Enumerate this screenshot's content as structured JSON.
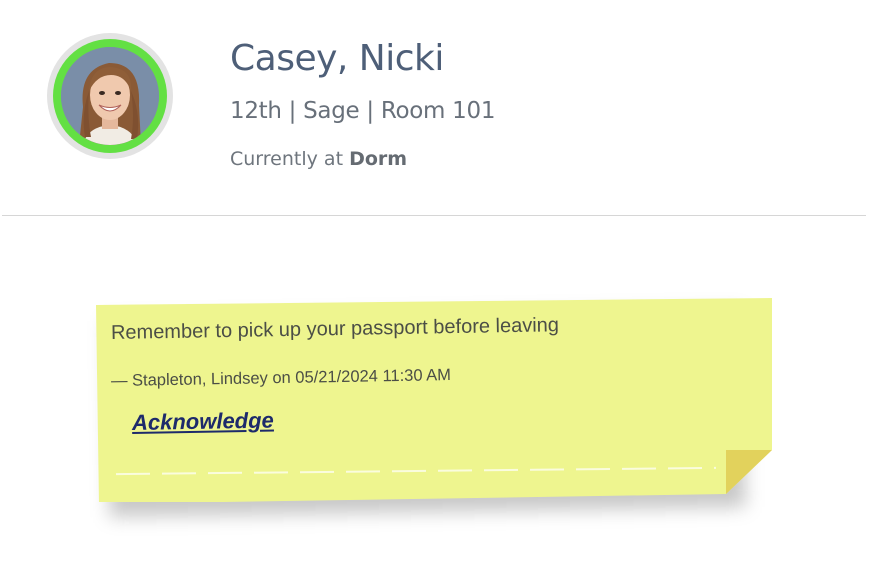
{
  "student": {
    "name": "Casey, Nicki",
    "details": "12th | Sage | Room 101",
    "location_prefix": "Currently at ",
    "location": "Dorm"
  },
  "avatar": {
    "status_ring_color": "#63e043",
    "icon": "student-photo"
  },
  "note": {
    "message": "Remember to pick up your passport before leaving",
    "attribution": "— Stapleton, Lindsey on 05/21/2024 11:30 AM",
    "action_label": "Acknowledge",
    "background_color": "#eef58f"
  }
}
